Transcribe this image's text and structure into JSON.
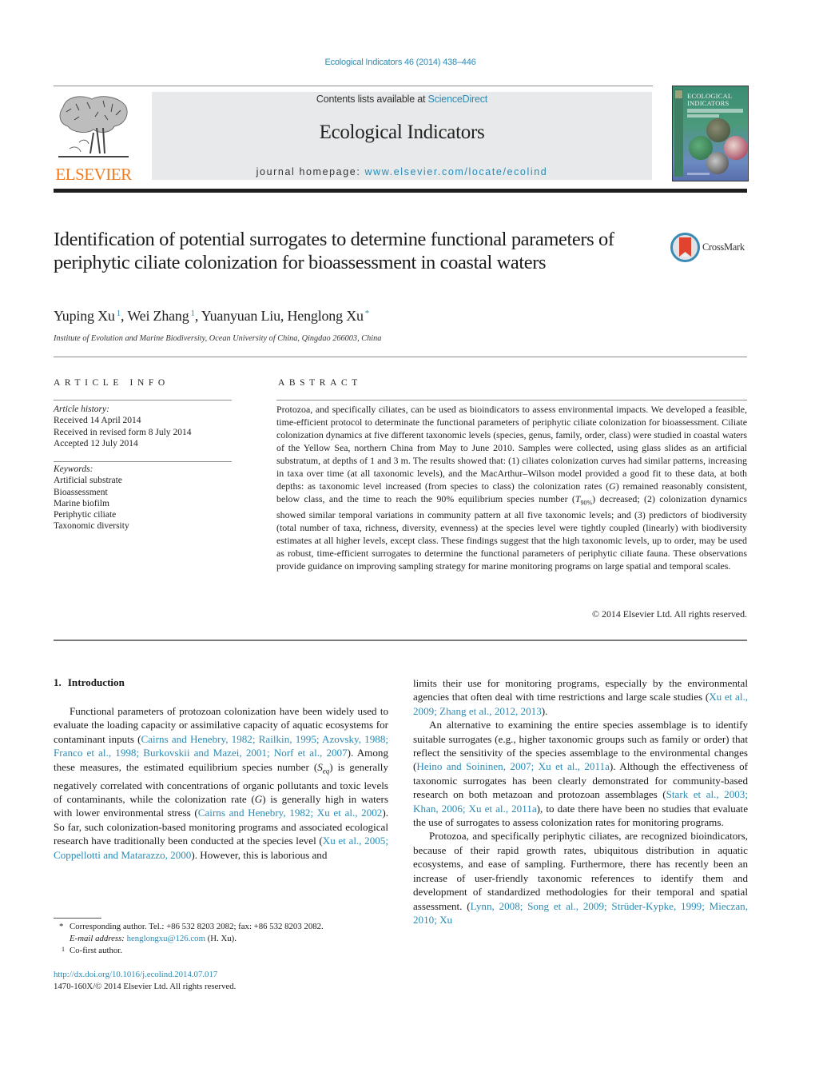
{
  "journal_ref": "Ecological Indicators 46 (2014) 438–446",
  "header": {
    "publisher": "ELSEVIER",
    "contents_prefix": "Contents lists available at ",
    "contents_link": "ScienceDirect",
    "journal_title": "Ecological Indicators",
    "homepage_prefix": "journal homepage: ",
    "homepage_link": "www.elsevier.com/locate/ecolind",
    "cover_title_line1": "ECOLOGICAL",
    "cover_title_line2": "INDICATORS",
    "accent_link_color": "#2a8bb5",
    "publisher_color": "#f07c21"
  },
  "article": {
    "title": "Identification of potential surrogates to determine functional parameters of periphytic ciliate colonization for bioassessment in coastal waters",
    "crossmark_label": "CrossMark",
    "authors": [
      {
        "name": "Yuping Xu",
        "mark": "1"
      },
      {
        "name": "Wei Zhang",
        "mark": "1"
      },
      {
        "name": "Yuanyuan Liu",
        "mark": ""
      },
      {
        "name": "Henglong Xu",
        "mark": "*"
      }
    ],
    "author_separator": ", ",
    "affiliation": "Institute of Evolution and Marine Biodiversity, Ocean University of China, Qingdao 266003, China"
  },
  "article_info": {
    "heading": "ARTICLE INFO",
    "history_label": "Article history:",
    "history": [
      "Received 14 April 2014",
      "Received in revised form 8 July 2014",
      "Accepted 12 July 2014"
    ],
    "keywords_label": "Keywords:",
    "keywords": [
      "Artificial substrate",
      "Bioassessment",
      "Marine biofilm",
      "Periphytic ciliate",
      "Taxonomic diversity"
    ]
  },
  "abstract": {
    "heading": "ABSTRACT",
    "text_part1": "Protozoa, and specifically ciliates, can be used as bioindicators to assess environmental impacts. We developed a feasible, time-efficient protocol to determinate the functional parameters of periphytic ciliate colonization for bioassessment. Ciliate colonization dynamics at five different taxonomic levels (species, genus, family, order, class) were studied in coastal waters of the Yellow Sea, northern China from May to June 2010. Samples were collected, using glass slides as an artificial substratum, at depths of 1 and 3 m. The results showed that: (1) ciliates colonization curves had similar patterns, increasing in taxa over time (at all taxonomic levels), and the MacArthur–Wilson model provided a good fit to these data, at both depths: as taxonomic level increased (from species to class) the colonization rates (",
    "symbol_G": "G",
    "text_part2": ") remained reasonably consistent, below class, and the time to reach the 90% equilibrium species number (",
    "symbol_T": "T",
    "symbol_T_sub": "90%",
    "text_part3": ") decreased; (2) colonization dynamics showed similar temporal variations in community pattern at all five taxonomic levels; and (3) predictors of biodiversity (total number of taxa, richness, diversity, evenness) at the species level were tightly coupled (linearly) with biodiversity estimates at all higher levels, except class. These findings suggest that the high taxonomic levels, up to order, may be used as robust, time-efficient surrogates to determine the functional parameters of periphytic ciliate fauna. These observations provide guidance on improving sampling strategy for marine monitoring programs on large spatial and temporal scales.",
    "copyright": "© 2014 Elsevier Ltd. All rights reserved."
  },
  "introduction": {
    "number": "1.",
    "heading": "Introduction",
    "left_p1": [
      {
        "t": "Functional parameters of protozoan colonization have been widely used to evaluate the loading capacity or assimilative capacity of aquatic ecosystems for contaminant inputs ("
      },
      {
        "t": "Cairns and Henebry, 1982; Railkin, 1995; Azovsky, 1988; Franco et al., 1998; Burkovskii and Mazei, 2001; Norf et al., 2007",
        "link": true
      },
      {
        "t": "). Among these measures, the estimated equilibrium species number ("
      },
      {
        "t": "S",
        "italic": true
      },
      {
        "t": "eq",
        "italic": true,
        "sub": true
      },
      {
        "t": ") is generally negatively correlated with concentrations of organic pollutants and toxic levels of contaminants, while the colonization rate ("
      },
      {
        "t": "G",
        "italic": true
      },
      {
        "t": ") is generally high in waters with lower environmental stress ("
      },
      {
        "t": "Cairns and Henebry, 1982; Xu et al., 2002",
        "link": true
      },
      {
        "t": "). So far, such colonization-based monitoring programs and associated ecological research have traditionally been conducted at the species level ("
      },
      {
        "t": "Xu et al., 2005; Coppellotti and Matarazzo, 2000",
        "link": true
      },
      {
        "t": "). However, this is laborious and"
      }
    ],
    "right_p1": [
      {
        "t": "limits their use for monitoring programs, especially by the environmental agencies that often deal with time restrictions and large scale studies ("
      },
      {
        "t": "Xu et al., 2009; Zhang et al., 2012, 2013",
        "link": true
      },
      {
        "t": ")."
      }
    ],
    "right_p2": [
      {
        "t": "An alternative to examining the entire species assemblage is to identify suitable surrogates (e.g., higher taxonomic groups such as family or order) that reflect the sensitivity of the species assemblage to the environmental changes ("
      },
      {
        "t": "Heino and Soininen, 2007; Xu et al., 2011a",
        "link": true
      },
      {
        "t": "). Although the effectiveness of taxonomic surrogates has been clearly demonstrated for community-based research on both metazoan and protozoan assemblages ("
      },
      {
        "t": "Stark et al., 2003; Khan, 2006; Xu et al., 2011a",
        "link": true
      },
      {
        "t": "), to date there have been no studies that evaluate the use of surrogates to assess colonization rates for monitoring programs."
      }
    ],
    "right_p3": [
      {
        "t": "Protozoa, and specifically periphytic ciliates, are recognized bioindicators, because of their rapid growth rates, ubiquitous distribution in aquatic ecosystems, and ease of sampling. Furthermore, there has recently been an increase of user-friendly taxonomic references to identify them and development of standardized methodologies for their temporal and spatial assessment. ("
      },
      {
        "t": "Lynn, 2008; Song et al., 2009; Strüder-Kypke, 1999; Mieczan, 2010; Xu",
        "link": true
      }
    ]
  },
  "footnotes": {
    "corresponding_mark": "*",
    "corresponding_text": "Corresponding author. Tel.: +86 532 8203 2082; fax: +86 532 8203 2082.",
    "email_label": "E-mail address: ",
    "email": "henglongxu@126.com",
    "email_suffix": " (H. Xu).",
    "cofirst_mark": "1",
    "cofirst_text": "Co-first author."
  },
  "doi": {
    "url": "http://dx.doi.org/10.1016/j.ecolind.2014.07.017",
    "issn_copyright": "1470-160X/© 2014 Elsevier Ltd. All rights reserved."
  }
}
